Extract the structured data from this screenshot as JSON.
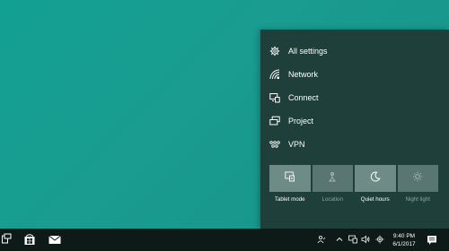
{
  "action_center": {
    "items": [
      {
        "label": "All settings",
        "icon": "gear-icon"
      },
      {
        "label": "Network",
        "icon": "network-icon"
      },
      {
        "label": "Connect",
        "icon": "connect-icon"
      },
      {
        "label": "Project",
        "icon": "project-icon"
      },
      {
        "label": "VPN",
        "icon": "vpn-icon"
      }
    ],
    "quick_actions": [
      {
        "label": "Tablet mode",
        "icon": "tablet-mode-icon",
        "active": true
      },
      {
        "label": "Location",
        "icon": "location-icon",
        "active": false
      },
      {
        "label": "Quiet hours",
        "icon": "moon-icon",
        "active": true
      },
      {
        "label": "Night light",
        "icon": "brightness-icon",
        "active": false
      }
    ]
  },
  "taskbar": {
    "clock_time": "9:40 PM",
    "clock_date": "6/1/2017",
    "icons": [
      "task-view-icon",
      "store-icon",
      "mail-icon"
    ],
    "tray_icons": [
      "people-icon",
      "chevron-up-icon",
      "action-icon",
      "volume-icon",
      "settings-icon"
    ]
  },
  "colors": {
    "desktop": "#12a093",
    "panel": "#1f3f3a",
    "tile_on": "#6f8b86",
    "tile_off": "#5a7672",
    "taskbar": "#0d1a18"
  }
}
